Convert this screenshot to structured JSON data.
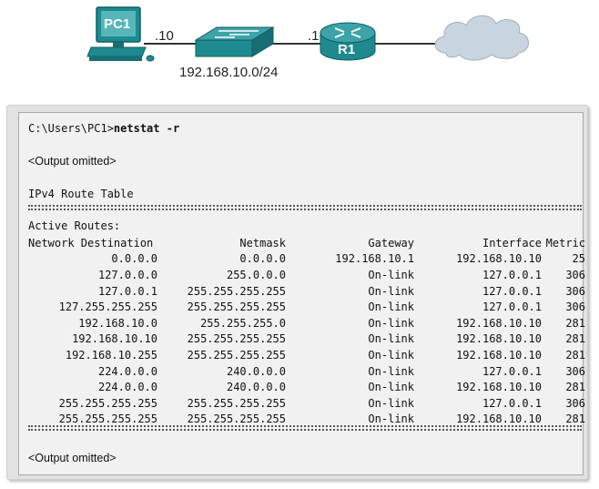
{
  "topology": {
    "pc_label": "PC1",
    "pc_port_label": ".10",
    "router_label": "R1",
    "router_port_label": ".1",
    "network_label": "192.168.10.0/24",
    "colors": {
      "device": "#1e8a8f",
      "cloud": "#c8d5df",
      "link": "#333333"
    }
  },
  "terminal": {
    "prompt": "C:\\Users\\PC1>",
    "command": "netstat -r",
    "omitted_top": "<Output omitted>",
    "table_title": "IPv4 Route Table",
    "section_title": "Active Routes:",
    "header": {
      "destination": "Network Destination",
      "netmask": "Netmask",
      "gateway": "Gateway",
      "interface": "Interface",
      "metric": "Metric"
    },
    "routes": [
      {
        "destination": "0.0.0.0",
        "netmask": "0.0.0.0",
        "gateway": "192.168.10.1",
        "interface": "192.168.10.10",
        "metric": "25"
      },
      {
        "destination": "127.0.0.0",
        "netmask": "255.0.0.0",
        "gateway": "On-link",
        "interface": "127.0.0.1",
        "metric": "306"
      },
      {
        "destination": "127.0.0.1",
        "netmask": "255.255.255.255",
        "gateway": "On-link",
        "interface": "127.0.0.1",
        "metric": "306"
      },
      {
        "destination": "127.255.255.255",
        "netmask": "255.255.255.255",
        "gateway": "On-link",
        "interface": "127.0.0.1",
        "metric": "306"
      },
      {
        "destination": "192.168.10.0",
        "netmask": "255.255.255.0",
        "gateway": "On-link",
        "interface": "192.168.10.10",
        "metric": "281"
      },
      {
        "destination": "192.168.10.10",
        "netmask": "255.255.255.255",
        "gateway": "On-link",
        "interface": "192.168.10.10",
        "metric": "281"
      },
      {
        "destination": "192.168.10.255",
        "netmask": "255.255.255.255",
        "gateway": "On-link",
        "interface": "192.168.10.10",
        "metric": "281"
      },
      {
        "destination": "224.0.0.0",
        "netmask": "240.0.0.0",
        "gateway": "On-link",
        "interface": "127.0.0.1",
        "metric": "306"
      },
      {
        "destination": "224.0.0.0",
        "netmask": "240.0.0.0",
        "gateway": "On-link",
        "interface": "192.168.10.10",
        "metric": "281"
      },
      {
        "destination": "255.255.255.255",
        "netmask": "255.255.255.255",
        "gateway": "On-link",
        "interface": "127.0.0.1",
        "metric": "306"
      },
      {
        "destination": "255.255.255.255",
        "netmask": "255.255.255.255",
        "gateway": "On-link",
        "interface": "192.168.10.10",
        "metric": "281"
      }
    ],
    "omitted_bottom": "<Output omitted>"
  }
}
